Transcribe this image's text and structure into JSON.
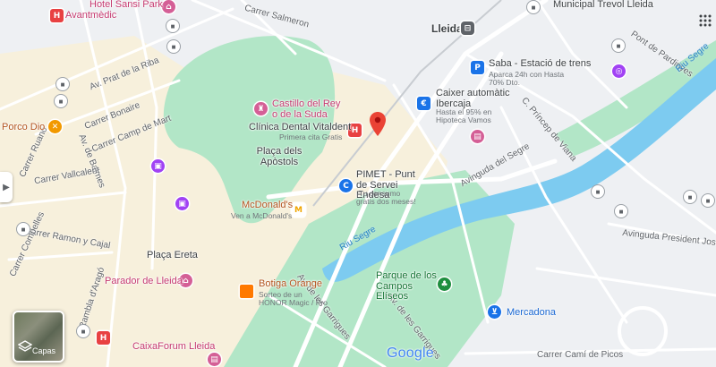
{
  "streets": [
    "Av. Prat de la Riba",
    "Carrer Bonaire",
    "Carrer Camp de Mart",
    "Carrer Salmeron",
    "Av. de Balmes",
    "Carrer Vallcalent",
    "Carrer Ramon y Cajal",
    "Rambla d'Aragó",
    "Av. de les Garrigues",
    "Av. de les Garrigues",
    "Avinguda del Segre",
    "C. Príncep de Viana",
    "Avinguda President Josep",
    "Pont de Pardinyes",
    "Carrer Camí de Picos",
    "Carrer Combelles",
    "Carrer Ruano"
  ],
  "water_labels": [
    "Riu Segre",
    "Riu Segre"
  ],
  "places": {
    "hotel": "Hotel Sansi Park",
    "avantmedic": "Avantmèdic",
    "municipal": "Municipal Trevol Lleida",
    "lleida": "Lleida",
    "saba_title": "Saba - Estació de trens",
    "saba_sub": "Aparca 24h con Hasta 70% Dto.",
    "caixer_title": "Caixer automàtic Ibercaja",
    "caixer_sub": "Hasta el 95% en Hipoteca Vamos",
    "castillo": "Castillo del Rey o de la Suda",
    "clinica_title": "Clínica Dental Vitaldent",
    "clinica_sub": "Primera cita Gratis",
    "placa_apostols": "Plaça dels Apòstols",
    "pimet_title": "PIMET - Punt de Servei Endesa",
    "pimet_sub": "¡Tu consumo gratis dos meses!",
    "mcdonalds_title": "McDonald's",
    "mcdonalds_sub": "Ven a McDonald's",
    "porco": "Porco Dio",
    "placa_ereta": "Plaça Ereta",
    "parador": "Parador de Lleida",
    "botiga_title": "Botiga Orange",
    "botiga_sub": "Sorteo de un HONOR Magic / Pro",
    "parque": "Parque de los Campos Elíseos",
    "mercadona": "Mercadona",
    "caixaforum": "CaixaForum Lleida"
  },
  "controls": {
    "layers_label": "Capas",
    "google_logo": "Google",
    "expand_icon": "chevron-right-icon",
    "apps_icon": "grid-icon"
  },
  "colors": {
    "park": "#b2e6c7",
    "river": "#7dcbf0",
    "oldtown": "#f7f0dc",
    "road": "#ffffff",
    "marker": "#ea4335"
  }
}
